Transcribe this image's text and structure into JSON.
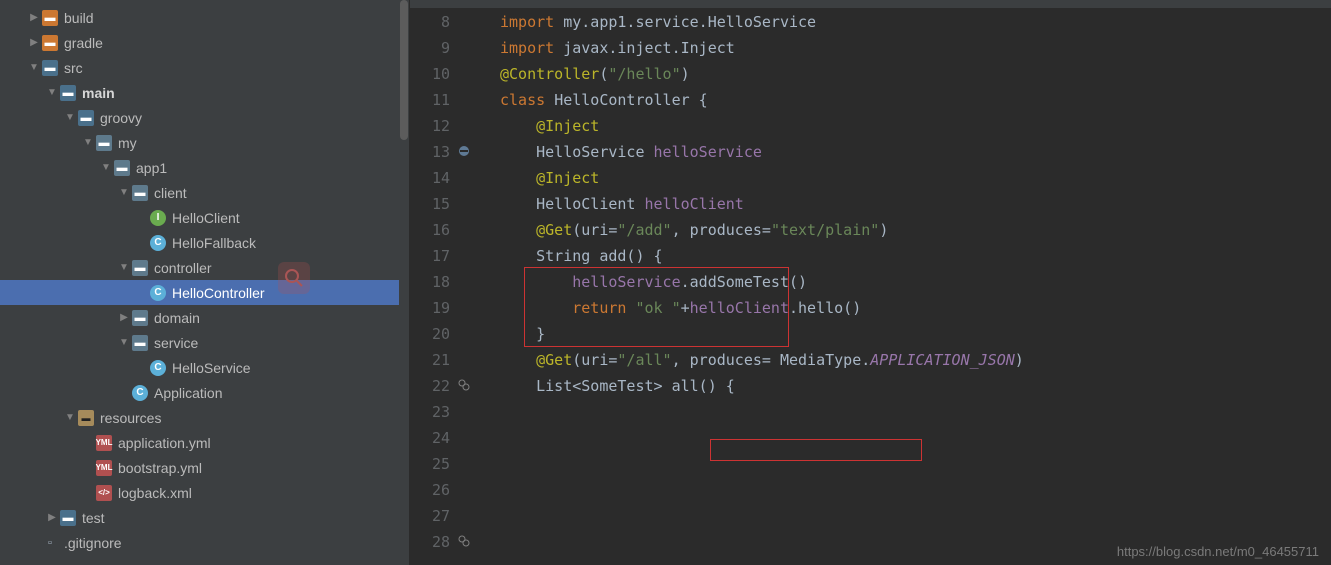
{
  "sidebar": {
    "items": [
      {
        "depth": 1,
        "arrow": "closed",
        "icon": "folder",
        "label": "build"
      },
      {
        "depth": 1,
        "arrow": "closed",
        "icon": "folder",
        "label": "gradle"
      },
      {
        "depth": 1,
        "arrow": "open",
        "icon": "folder-src",
        "label": "src"
      },
      {
        "depth": 2,
        "arrow": "open",
        "icon": "folder-src",
        "label": "main",
        "bold": true
      },
      {
        "depth": 3,
        "arrow": "open",
        "icon": "folder-src",
        "label": "groovy"
      },
      {
        "depth": 4,
        "arrow": "open",
        "icon": "folder-pkg",
        "label": "my"
      },
      {
        "depth": 5,
        "arrow": "open",
        "icon": "folder-pkg",
        "label": "app1"
      },
      {
        "depth": 6,
        "arrow": "open",
        "icon": "folder-pkg",
        "label": "client"
      },
      {
        "depth": 7,
        "arrow": "none",
        "icon": "interface",
        "label": "HelloClient"
      },
      {
        "depth": 7,
        "arrow": "none",
        "icon": "class",
        "label": "HelloFallback"
      },
      {
        "depth": 6,
        "arrow": "open",
        "icon": "folder-pkg",
        "label": "controller"
      },
      {
        "depth": 7,
        "arrow": "none",
        "icon": "class",
        "label": "HelloController",
        "selected": true
      },
      {
        "depth": 6,
        "arrow": "closed",
        "icon": "folder-pkg",
        "label": "domain"
      },
      {
        "depth": 6,
        "arrow": "open",
        "icon": "folder-pkg",
        "label": "service"
      },
      {
        "depth": 7,
        "arrow": "none",
        "icon": "class",
        "label": "HelloService"
      },
      {
        "depth": 6,
        "arrow": "none",
        "icon": "class",
        "label": "Application"
      },
      {
        "depth": 3,
        "arrow": "open",
        "icon": "folder-res",
        "label": "resources"
      },
      {
        "depth": 4,
        "arrow": "none",
        "icon": "yml",
        "label": "application.yml"
      },
      {
        "depth": 4,
        "arrow": "none",
        "icon": "yml",
        "label": "bootstrap.yml"
      },
      {
        "depth": 4,
        "arrow": "none",
        "icon": "xml",
        "label": "logback.xml"
      },
      {
        "depth": 2,
        "arrow": "closed",
        "icon": "folder-src",
        "label": "test"
      },
      {
        "depth": 1,
        "arrow": "none",
        "icon": "file",
        "label": ".gitignore"
      }
    ]
  },
  "editor": {
    "lines": [
      {
        "num": 8,
        "tokens": [
          [
            "kw",
            "import"
          ],
          [
            "",
            " my.app1.service.HelloService"
          ]
        ]
      },
      {
        "num": 9,
        "tokens": [
          [
            "",
            ""
          ]
        ]
      },
      {
        "num": 10,
        "tokens": [
          [
            "kw",
            "import"
          ],
          [
            "",
            " javax.inject.Inject"
          ]
        ]
      },
      {
        "num": 11,
        "tokens": [
          [
            "",
            ""
          ]
        ]
      },
      {
        "num": 12,
        "tokens": [
          [
            "ann",
            "@Controller"
          ],
          [
            "",
            "("
          ],
          [
            "str",
            "\"/hello\""
          ],
          [
            "",
            ")"
          ]
        ]
      },
      {
        "num": 13,
        "tokens": [
          [
            "kw",
            "class "
          ],
          [
            "cls",
            "HelloController"
          ],
          [
            "",
            " {"
          ]
        ],
        "gutterIcon": "no-entry"
      },
      {
        "num": 14,
        "tokens": [
          [
            "",
            ""
          ]
        ]
      },
      {
        "num": 15,
        "tokens": [
          [
            "",
            "    "
          ],
          [
            "ann",
            "@Inject"
          ]
        ]
      },
      {
        "num": 16,
        "tokens": [
          [
            "",
            "    HelloService "
          ],
          [
            "field",
            "helloService"
          ]
        ]
      },
      {
        "num": 17,
        "tokens": [
          [
            "",
            ""
          ]
        ]
      },
      {
        "num": 18,
        "tokens": [
          [
            "",
            "    "
          ],
          [
            "ann",
            "@Inject"
          ]
        ]
      },
      {
        "num": 19,
        "tokens": [
          [
            "",
            "    HelloClient "
          ],
          [
            "field",
            "helloClient"
          ]
        ]
      },
      {
        "num": 20,
        "tokens": [
          [
            "",
            ""
          ]
        ]
      },
      {
        "num": 21,
        "tokens": [
          [
            "",
            "    "
          ],
          [
            "ann",
            "@Get"
          ],
          [
            "",
            "(uri="
          ],
          [
            "str",
            "\"/add\""
          ],
          [
            "",
            ", produces="
          ],
          [
            "str",
            "\"text/plain\""
          ],
          [
            "",
            ")"
          ]
        ]
      },
      {
        "num": 22,
        "tokens": [
          [
            "",
            "    String add() {"
          ]
        ],
        "gutterIcon": "link"
      },
      {
        "num": 23,
        "tokens": [
          [
            "",
            "        "
          ],
          [
            "field",
            "helloService"
          ],
          [
            "",
            ".addSomeTest()"
          ]
        ]
      },
      {
        "num": 24,
        "tokens": [
          [
            "",
            "        "
          ],
          [
            "kw",
            "return "
          ],
          [
            "str",
            "\"ok \""
          ],
          [
            "",
            "+"
          ],
          [
            "field",
            "helloClient"
          ],
          [
            "",
            ".hello()"
          ]
        ]
      },
      {
        "num": 25,
        "tokens": [
          [
            "",
            "    }"
          ]
        ]
      },
      {
        "num": 26,
        "tokens": [
          [
            "",
            ""
          ]
        ]
      },
      {
        "num": 27,
        "tokens": [
          [
            "",
            "    "
          ],
          [
            "ann",
            "@Get"
          ],
          [
            "",
            "(uri="
          ],
          [
            "str",
            "\"/all\""
          ],
          [
            "",
            ", produces= MediaType."
          ],
          [
            "const",
            "APPLICATION_JSON"
          ],
          [
            "",
            ")"
          ]
        ]
      },
      {
        "num": 28,
        "tokens": [
          [
            "",
            "    List<SomeTest> all() {"
          ]
        ],
        "gutterIcon": "link"
      }
    ]
  },
  "watermark": "https://blog.csdn.net/m0_46455711",
  "icon_glyphs": {
    "folder": "▬",
    "folder-src": "▬",
    "folder-pkg": "▬",
    "folder-res": "▬",
    "class": "C",
    "interface": "I",
    "yml": "YML",
    "xml": "</>",
    "file": "▫"
  }
}
